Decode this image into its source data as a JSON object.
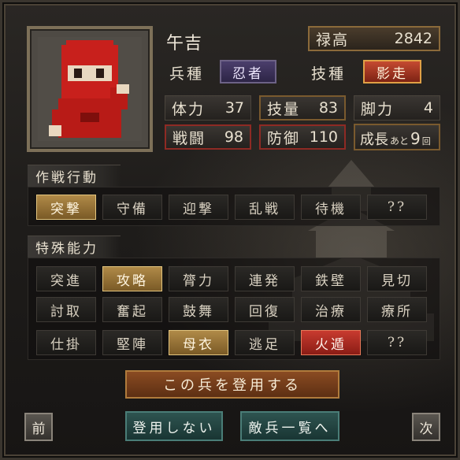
{
  "unit": {
    "name": "午吉"
  },
  "stipend": {
    "label": "禄高",
    "value": "2842"
  },
  "troop_type": {
    "label": "兵種",
    "value": "忍者"
  },
  "skill_type": {
    "label": "技種",
    "value": "影走"
  },
  "stats": {
    "hp": {
      "label": "体力",
      "value": "37"
    },
    "skill": {
      "label": "技量",
      "value": "83"
    },
    "leg": {
      "label": "脚力",
      "value": "4"
    },
    "combat": {
      "label": "戦闘",
      "value": "98"
    },
    "defense": {
      "label": "防御",
      "value": "110"
    }
  },
  "growth": {
    "label": "成長",
    "prefix": "あと",
    "value": "9",
    "unit": "回"
  },
  "tactics": {
    "title": "作戦行動",
    "items": [
      "突撃",
      "守備",
      "迎撃",
      "乱戦",
      "待機",
      "??"
    ],
    "selected_index": 0
  },
  "abilities": {
    "title": "特殊能力",
    "rows": [
      [
        "突進",
        "攻略",
        "膂力",
        "連発",
        "鉄壁",
        "見切"
      ],
      [
        "討取",
        "奮起",
        "鼓舞",
        "回復",
        "治療",
        "療所"
      ],
      [
        "仕掛",
        "堅陣",
        "母衣",
        "逃足",
        "火遁",
        "??"
      ]
    ]
  },
  "buttons": {
    "hire": "この兵を登用する",
    "decline": "登用しない",
    "enemy_list": "敵兵一覧へ",
    "prev": "前",
    "next": "次"
  },
  "colors": {
    "selected_gold": "#b08a48",
    "fire_red": "#c83b2f",
    "ninja_red": "#c8201c"
  }
}
